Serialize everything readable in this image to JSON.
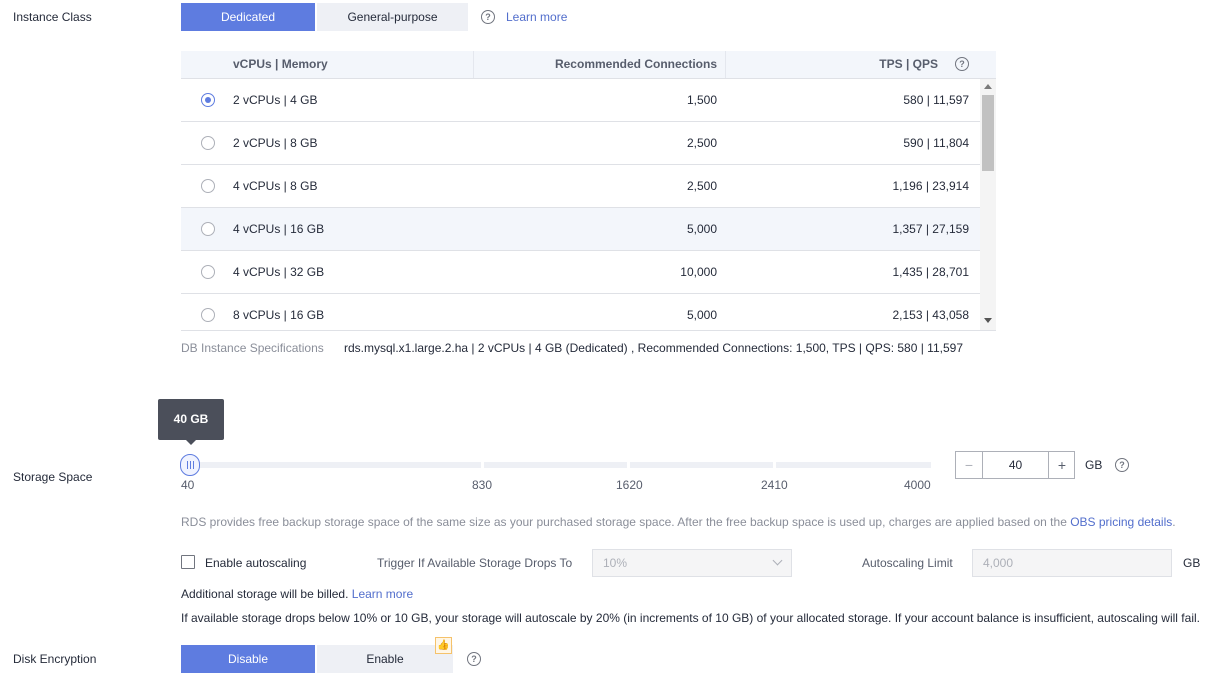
{
  "instance_class": {
    "label": "Instance Class",
    "options": [
      "Dedicated",
      "General-purpose"
    ],
    "selected": "Dedicated",
    "learn_more": "Learn more"
  },
  "table": {
    "headers": [
      "vCPUs | Memory",
      "Recommended Connections",
      "TPS | QPS"
    ],
    "rows": [
      {
        "spec": "2 vCPUs | 4 GB",
        "connections": "1,500",
        "tps_qps": "580 | 11,597",
        "selected": true
      },
      {
        "spec": "2 vCPUs | 8 GB",
        "connections": "2,500",
        "tps_qps": "590 | 11,804",
        "selected": false
      },
      {
        "spec": "4 vCPUs | 8 GB",
        "connections": "2,500",
        "tps_qps": "1,196 | 23,914",
        "selected": false
      },
      {
        "spec": "4 vCPUs | 16 GB",
        "connections": "5,000",
        "tps_qps": "1,357 | 27,159",
        "selected": false
      },
      {
        "spec": "4 vCPUs | 32 GB",
        "connections": "10,000",
        "tps_qps": "1,435 | 28,701",
        "selected": false
      },
      {
        "spec": "8 vCPUs | 16 GB",
        "connections": "5,000",
        "tps_qps": "2,153 | 43,058",
        "selected": false
      }
    ]
  },
  "spec_summary": {
    "label": "DB Instance Specifications",
    "value": "rds.mysql.x1.large.2.ha | 2 vCPUs | 4 GB (Dedicated) , Recommended Connections: 1,500, TPS | QPS: 580 | 11,597"
  },
  "storage": {
    "label": "Storage Space",
    "tooltip": "40 GB",
    "ticks": [
      "40",
      "830",
      "1620",
      "2410",
      "4000"
    ],
    "value": "40",
    "unit": "GB",
    "min": 40,
    "max": 4000,
    "note_prefix": "RDS provides free backup storage space of the same size as your purchased storage space. After the free backup space is used up, charges are applied based on the ",
    "note_link": "OBS pricing details",
    "note_suffix": "."
  },
  "autoscaling": {
    "checkbox_label": "Enable autoscaling",
    "trigger_label": "Trigger If Available Storage Drops To",
    "trigger_value": "10%",
    "limit_label": "Autoscaling Limit",
    "limit_placeholder": "4,000",
    "limit_unit": "GB",
    "billed_note": "Additional storage will be billed.",
    "billed_link": "Learn more",
    "description": "If available storage drops below 10% or 10 GB, your storage will autoscale by 20% (in increments of 10 GB) of your allocated storage. If your account balance is insufficient, autoscaling will fail."
  },
  "disk_encryption": {
    "label": "Disk Encryption",
    "options": [
      "Disable",
      "Enable"
    ],
    "selected": "Disable"
  },
  "colors": {
    "accent": "#5e7ce0",
    "link": "#526ecc",
    "recommend_badge": "#f5a623"
  }
}
